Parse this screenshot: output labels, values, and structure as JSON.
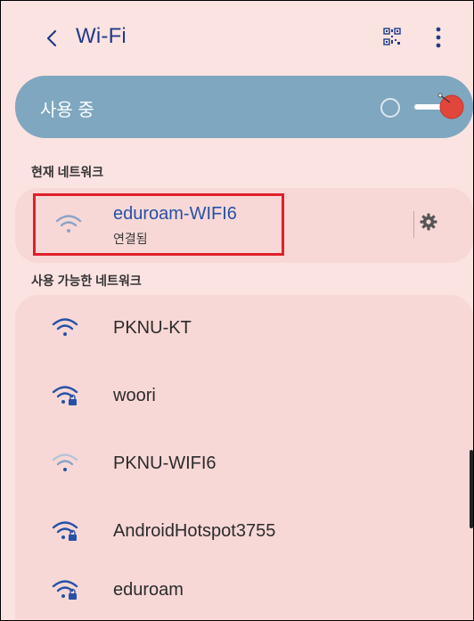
{
  "header": {
    "title": "Wi-Fi",
    "back_icon": "chevron-left-icon",
    "qr_icon": "qr-code-icon",
    "more_icon": "more-vertical-icon"
  },
  "master_toggle": {
    "label": "사용 중",
    "state": "on"
  },
  "current_network": {
    "section_title": "현재 네트워크",
    "name": "eduroam-WIFI6",
    "status": "연결됨",
    "icon": "wifi-icon",
    "settings_icon": "gear-icon"
  },
  "available": {
    "section_title": "사용 가능한 네트워크",
    "networks": [
      {
        "name": "PKNU-KT",
        "secured": false,
        "strength": "full"
      },
      {
        "name": "woori",
        "secured": true,
        "strength": "full"
      },
      {
        "name": "PKNU-WIFI6",
        "secured": false,
        "strength": "weak"
      },
      {
        "name": "AndroidHotspot3755",
        "secured": true,
        "strength": "full"
      },
      {
        "name": "eduroam",
        "secured": true,
        "strength": "full"
      }
    ]
  },
  "colors": {
    "background": "#fbe3e1",
    "card": "#f7d8d6",
    "accent": "#2651a6",
    "toggle_bar": "#7fa7bf",
    "highlight": "#e0202a"
  }
}
